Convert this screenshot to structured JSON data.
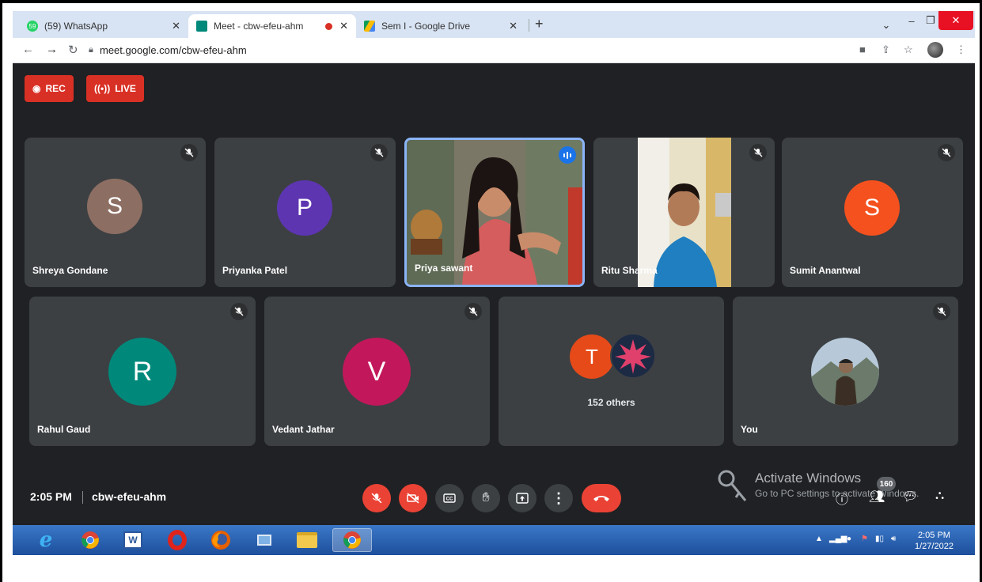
{
  "browser": {
    "tabs": [
      {
        "label": "(59) WhatsApp",
        "badge": "59",
        "color": "#25d366"
      },
      {
        "label": "Meet - cbw-efeu-ahm",
        "color": "#00897b"
      },
      {
        "label": "Sem I - Google Drive",
        "color": "#fbbc04"
      }
    ],
    "new_tab_label": "+",
    "url": "meet.google.com/cbw-efeu-ahm",
    "window_controls": {
      "minimize": "–",
      "restore": "❐",
      "close": "✕",
      "tab_list": "⌄"
    }
  },
  "meet": {
    "rec_label": "REC",
    "live_label": "LIVE",
    "participants_row1": [
      {
        "name": "Shreya Gondane",
        "initial": "S",
        "color": "#8d6e63"
      },
      {
        "name": "Priyanka Patel",
        "initial": "P",
        "color": "#5e35b1"
      },
      {
        "name": "Priya sawant",
        "initial": "",
        "color": "#3c4043",
        "video": true,
        "speaking": true
      },
      {
        "name": "Ritu Sharma",
        "initial": "",
        "color": "#3c4043",
        "video": true
      },
      {
        "name": "Sumit Anantwal",
        "initial": "S",
        "color": "#f4511e"
      }
    ],
    "participants_row2": [
      {
        "name": "Rahul Gaud",
        "initial": "R",
        "color": "#00897b"
      },
      {
        "name": "Vedant Jathar",
        "initial": "V",
        "color": "#c2185b"
      }
    ],
    "others": {
      "initial": "T",
      "color": "#e64a19",
      "label": "152 others"
    },
    "self_label": "You",
    "time": "2:05 PM",
    "meeting_code": "cbw-efeu-ahm",
    "participant_count": "160",
    "watermark": {
      "line1": "Activate Windows",
      "line2": "Go to PC settings to activate Windows."
    }
  },
  "taskbar": {
    "clock_time": "2:05 PM",
    "clock_date": "1/27/2022"
  }
}
